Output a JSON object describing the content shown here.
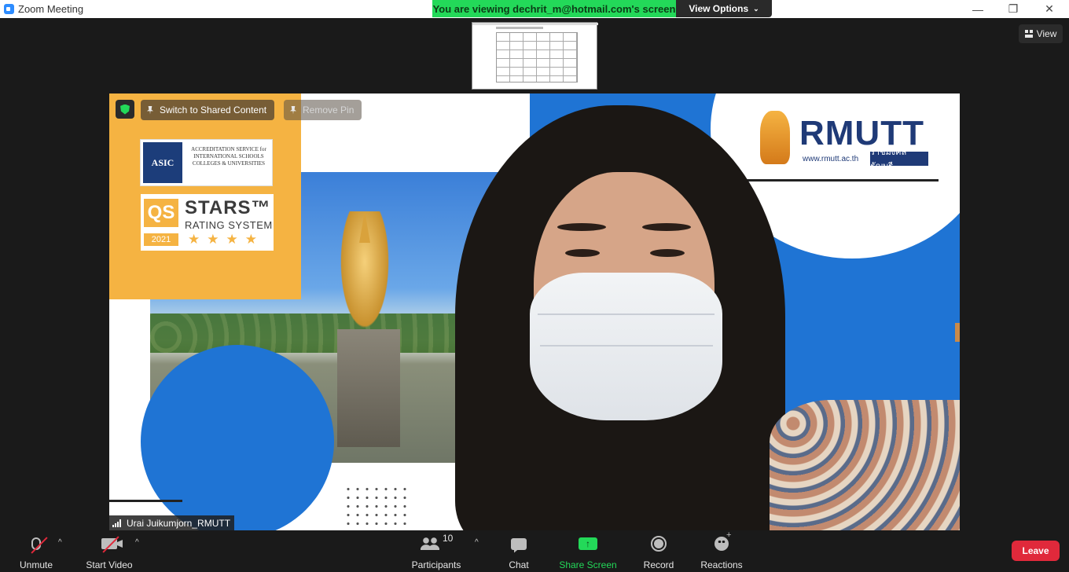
{
  "window": {
    "title": "Zoom Meeting",
    "controls": {
      "minimize": "—",
      "restore": "❐",
      "close": "✕"
    }
  },
  "banner": {
    "viewing_text": "You are viewing dechrit_m@hotmail.com's screen",
    "view_options_label": "View Options",
    "view_options_chevron": "⌄"
  },
  "view_button": {
    "label": "View"
  },
  "video": {
    "overlay": {
      "switch_label": "Switch to Shared Content",
      "remove_pin_label": "Remove Pin"
    },
    "participant_name": "Urai Juikumjorn_RMUTT",
    "background": {
      "asic_mark": "ASIC",
      "asic_text": "ACCREDITATION SERVICE for INTERNATIONAL SCHOOLS COLLEGES & UNIVERSITIES",
      "qs_mark": "QS",
      "qs_stars": "STARS™",
      "qs_rating": "RATING SYSTEM",
      "qs_year": "2021",
      "qs_star_row": "★★★★",
      "rmutt_word": "RMUTT",
      "rmutt_url": "www.rmutt.ac.th",
      "rmutt_thai": "ราชมงคลธัญบุรี"
    }
  },
  "toolbar": {
    "unmute_label": "Unmute",
    "start_video_label": "Start Video",
    "caret": "^",
    "participants_label": "Participants",
    "participants_count": "10",
    "chat_label": "Chat",
    "share_label": "Share Screen",
    "share_arrow": "↑",
    "record_label": "Record",
    "reactions_label": "Reactions",
    "leave_label": "Leave"
  },
  "colors": {
    "zoom_blue": "#2d8cff",
    "viewing_green": "#23d959",
    "leave_red": "#e0293b",
    "toolbar_bg": "#1a1a1a"
  },
  "icons": [
    "zoom-app-icon",
    "grid-icon",
    "shield-icon",
    "pin-icon",
    "signal-icon",
    "mic-muted-icon",
    "video-off-icon",
    "participants-icon",
    "chat-icon",
    "share-screen-icon",
    "record-icon",
    "reactions-icon"
  ]
}
